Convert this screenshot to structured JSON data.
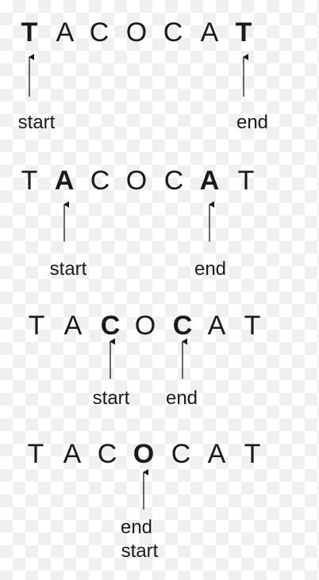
{
  "steps": [
    {
      "letters": [
        "T",
        "A",
        "C",
        "O",
        "C",
        "A",
        "T"
      ],
      "start_index": 0,
      "end_index": 6,
      "labels": [
        "start",
        "end"
      ]
    },
    {
      "letters": [
        "T",
        "A",
        "C",
        "O",
        "C",
        "A",
        "T"
      ],
      "start_index": 1,
      "end_index": 5,
      "labels": [
        "start",
        "end"
      ]
    },
    {
      "letters": [
        "T",
        "A",
        "C",
        "O",
        "C",
        "A",
        "T"
      ],
      "start_index": 2,
      "end_index": 4,
      "labels": [
        "start",
        "end"
      ]
    },
    {
      "letters": [
        "T",
        "A",
        "C",
        "O",
        "C",
        "A",
        "T"
      ],
      "start_index": 3,
      "end_index": 3,
      "labels": [
        "end",
        "start"
      ]
    }
  ],
  "colors": {
    "text": "#1a1a1a",
    "arrow": "#1a1a1a"
  }
}
